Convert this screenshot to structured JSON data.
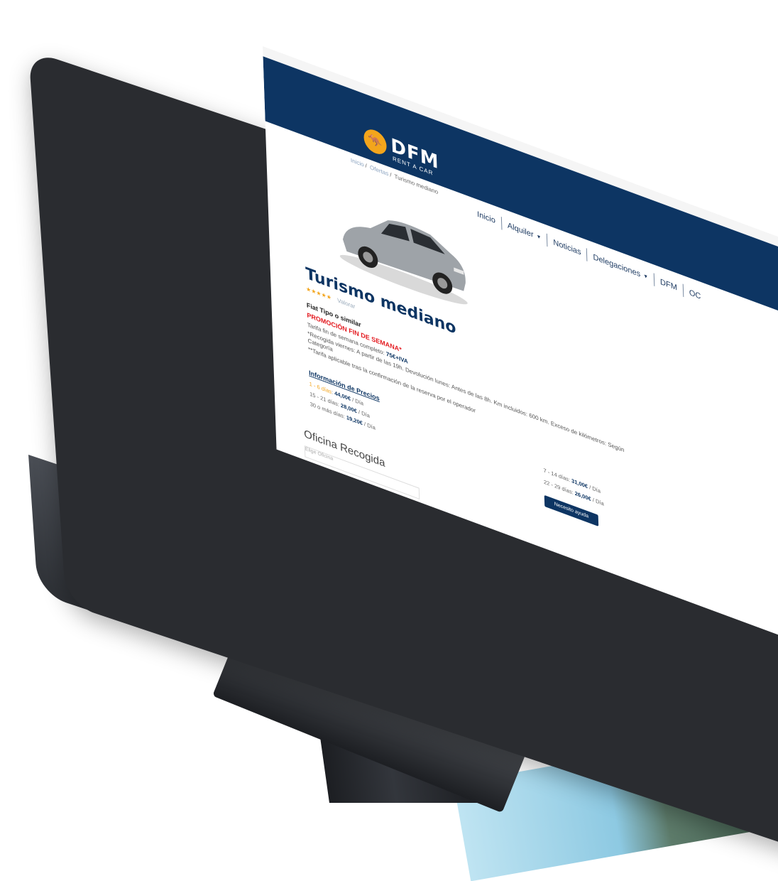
{
  "brand": {
    "name": "DFM",
    "subtitle": "RENT A CAR"
  },
  "nav": {
    "items": [
      {
        "label": "Inicio"
      },
      {
        "label": "Alquiler",
        "dropdown": true
      },
      {
        "label": "Noticias"
      },
      {
        "label": "Delegaciones",
        "dropdown": true
      },
      {
        "label": "DFM"
      },
      {
        "label": "OC"
      }
    ]
  },
  "breadcrumb": {
    "home": "Inicio",
    "section": "Ofertas",
    "current": "Turismo mediano"
  },
  "product": {
    "title": "Turismo mediano",
    "stars": "★★★★★",
    "rating_link": "Valorar",
    "model": "Fiat Tipo o similar",
    "promo": "PROMOCIÓN FIN DE SEMANA*",
    "rate_label": "Tarifa fin de semana completo:",
    "rate_value": "75€+IVA",
    "pickup_note": "*Recogida viernes: A partir de las 19h. Devolución lunes: Antes de las 8h. Km incluidos: 600 km. Exceso de kilómetros: Según",
    "pickup_note_cont": "Categoría",
    "conditions_note": "**Tarifa aplicable tras la confirmación de la reserva por el operador"
  },
  "prices": {
    "title": "Información de Precios",
    "left": [
      {
        "range": "1 - 6 días",
        "value": "44,00€",
        "unit": "/ Día"
      },
      {
        "range": "15 - 21 días",
        "value": "28,00€",
        "unit": "/ Día"
      },
      {
        "range": "30 o más días",
        "value": "19,20€",
        "unit": "/ Día"
      }
    ],
    "right": [
      {
        "range": "7 - 14 días",
        "value": "31,00€",
        "unit": "/ Día"
      },
      {
        "range": "22 - 29 días",
        "value": "26,00€",
        "unit": "/ Día"
      }
    ]
  },
  "office": {
    "label": "Oficina Recogida",
    "placeholder": "Elige Oficina"
  },
  "cta": {
    "label": "Necesito ayuda"
  },
  "colors": {
    "navy": "#0d3563",
    "accent": "#f3a51c",
    "promo_red": "#e3191f"
  }
}
